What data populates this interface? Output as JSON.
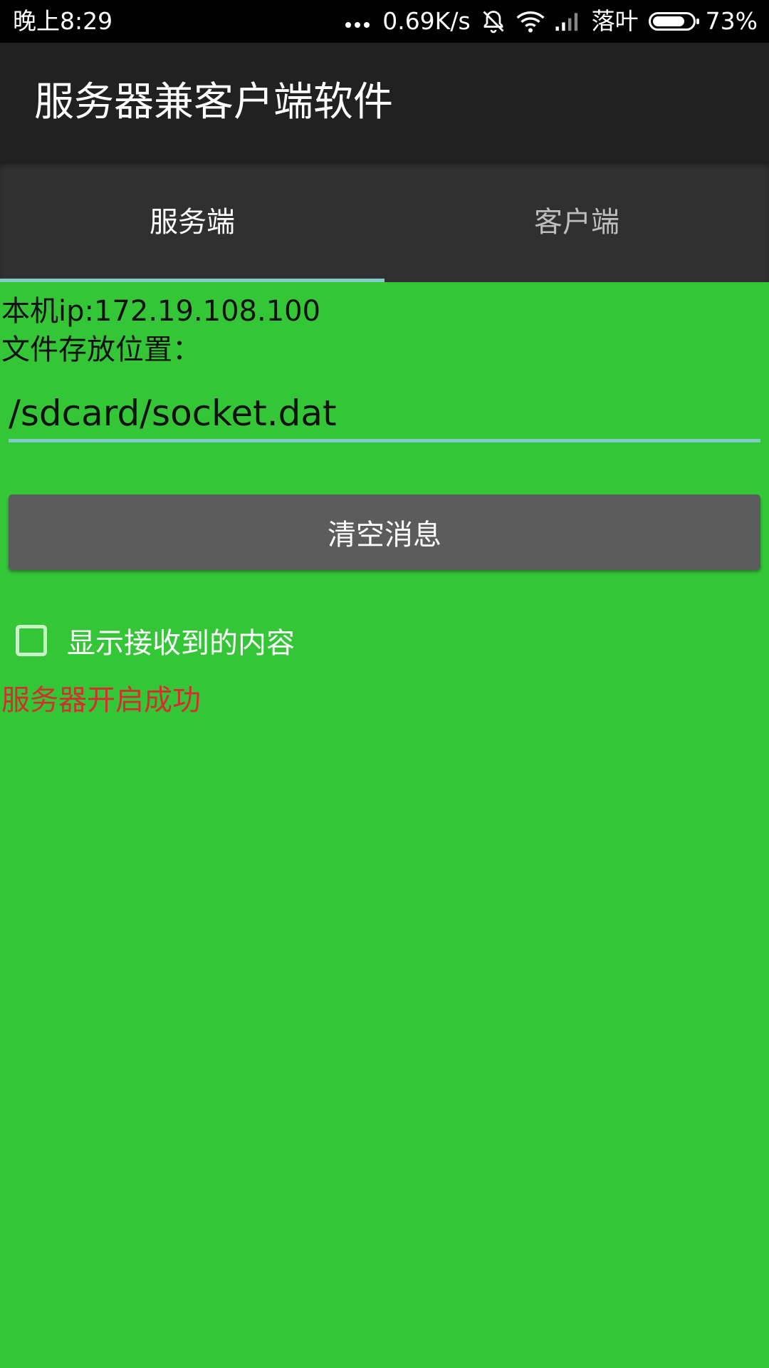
{
  "status_bar": {
    "time": "晚上8:29",
    "network_speed": "0.69K/s",
    "carrier": "落叶",
    "battery_percent": "73%",
    "icons": [
      "more-dots-icon",
      "mute-icon",
      "wifi-icon",
      "signal-icon",
      "battery-icon"
    ]
  },
  "app_bar": {
    "title": "服务器兼客户端软件"
  },
  "tabs": [
    {
      "label": "服务端",
      "active": true
    },
    {
      "label": "客户端",
      "active": false
    }
  ],
  "main": {
    "ip_line": "本机ip:172.19.108.100",
    "path_label": "文件存放位置：",
    "path_value": "/sdcard/socket.dat",
    "clear_button": "清空消息",
    "show_received_label": "显示接收到的内容",
    "show_received_checked": false,
    "status_message": "服务器开启成功"
  },
  "colors": {
    "background": "#35c638",
    "accent": "#80cbc4",
    "status_text": "#d32f2f"
  }
}
